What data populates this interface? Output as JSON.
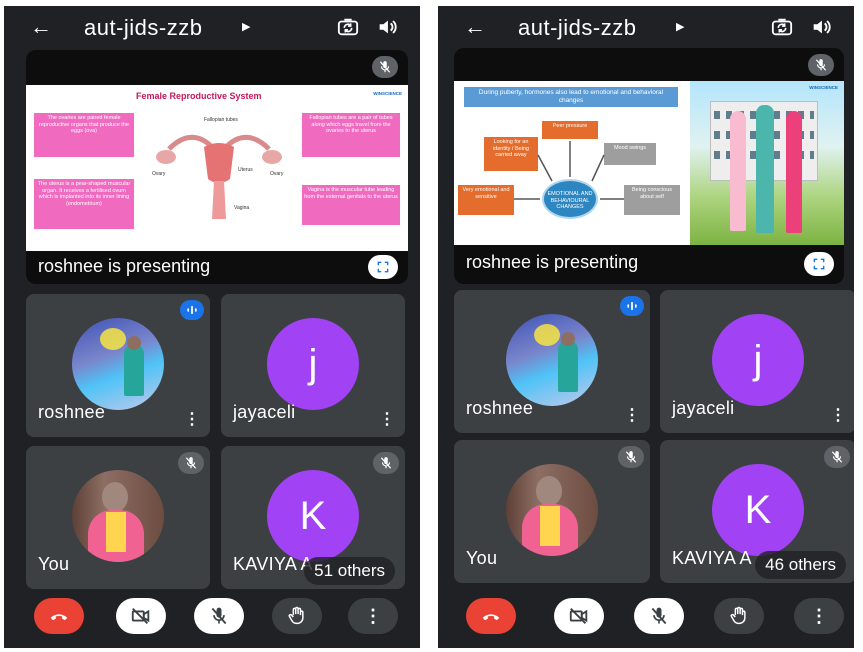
{
  "colors": {
    "background": "#202124",
    "tile": "#3c4043",
    "hangup": "#ea4335",
    "avatar_purple": "#a142f4",
    "voice_badge": "#1a73e8"
  },
  "screens": [
    {
      "meeting_code": "aut-jids-zzb",
      "presenting_label": "roshnee is presenting",
      "slide": {
        "title": "Female Reproductive System",
        "logo_text": "WINSCIENCE",
        "boxes": [
          "The ovaries are paired female reproductive organs that produce the eggs (ova)",
          "Fallopian tubes are a pair of tubes along which eggs travel from the ovaries to the uterus",
          "The uterus is a pear-shaped muscular organ. It receives a fertilised ovum which is implanted into its inner lining (endometrium)",
          "Vagina is the muscular tube leading from the external genitals to the uterus"
        ],
        "diagram_labels": [
          "Fallopian tubes",
          "Ovary",
          "Ovary",
          "Uterus",
          "Vagina"
        ]
      },
      "participants": [
        {
          "name": "roshnee",
          "status": "speaking",
          "menu": "⋮",
          "avatar": "photo"
        },
        {
          "name": "jayaceli",
          "status": "",
          "menu": "⋮",
          "initial": "j"
        },
        {
          "name": "You",
          "status": "muted",
          "avatar": "photo"
        },
        {
          "name": "KAVIYA A",
          "status": "muted",
          "initial": "K",
          "others_label": "51 others"
        }
      ],
      "controls": [
        "hang-up",
        "camera-off",
        "mic-off",
        "raise-hand",
        "more-options"
      ]
    },
    {
      "meeting_code": "aut-jids-zzb",
      "presenting_label": "roshnee is presenting",
      "slide": {
        "title": "During puberty, hormones also lead to emotional and behavioral changes",
        "logo_text": "WINSCIENCE",
        "center_label": "EMOTIONAL AND BEHAVIOURAL CHANGES",
        "boxes": [
          "Peer pressure",
          "Looking for an identity / Being carried away",
          "Mood swings",
          "Very emotional and sensitive",
          "Being conscious about self"
        ]
      },
      "participants": [
        {
          "name": "roshnee",
          "status": "speaking",
          "menu": "⋮",
          "avatar": "photo"
        },
        {
          "name": "jayaceli",
          "status": "",
          "menu": "⋮",
          "initial": "j"
        },
        {
          "name": "You",
          "status": "muted",
          "avatar": "photo"
        },
        {
          "name": "KAVIYA A",
          "status": "muted",
          "initial": "K",
          "others_label": "46 others"
        }
      ],
      "controls": [
        "hang-up",
        "camera-off",
        "mic-off",
        "raise-hand",
        "more-options"
      ]
    }
  ]
}
